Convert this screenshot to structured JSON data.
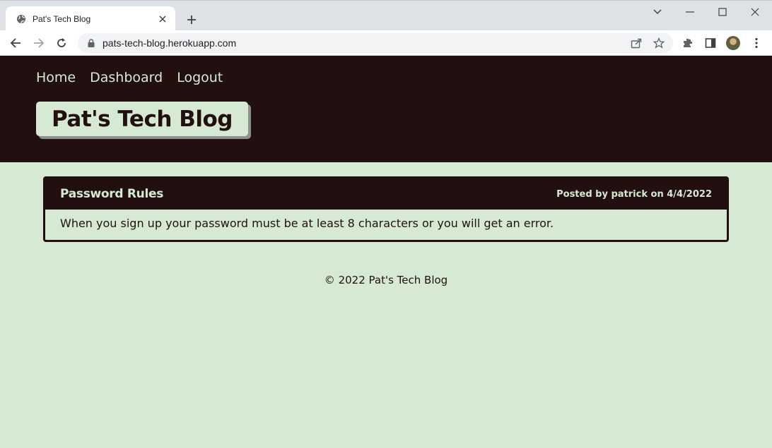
{
  "browser": {
    "tab_title": "Pat's Tech Blog",
    "url": "pats-tech-blog.herokuapp.com"
  },
  "nav": {
    "items": [
      "Home",
      "Dashboard",
      "Logout"
    ]
  },
  "site": {
    "title": "Pat's Tech Blog"
  },
  "post": {
    "title": "Password Rules",
    "meta": "Posted by patrick on 4/4/2022",
    "body": "When you sign up your password must be at least 8 characters or you will get an error."
  },
  "footer": {
    "text": "© 2022 Pat's Tech Blog"
  },
  "colors": {
    "primary_dark": "#221010",
    "primary_light": "#d6e9d3"
  }
}
